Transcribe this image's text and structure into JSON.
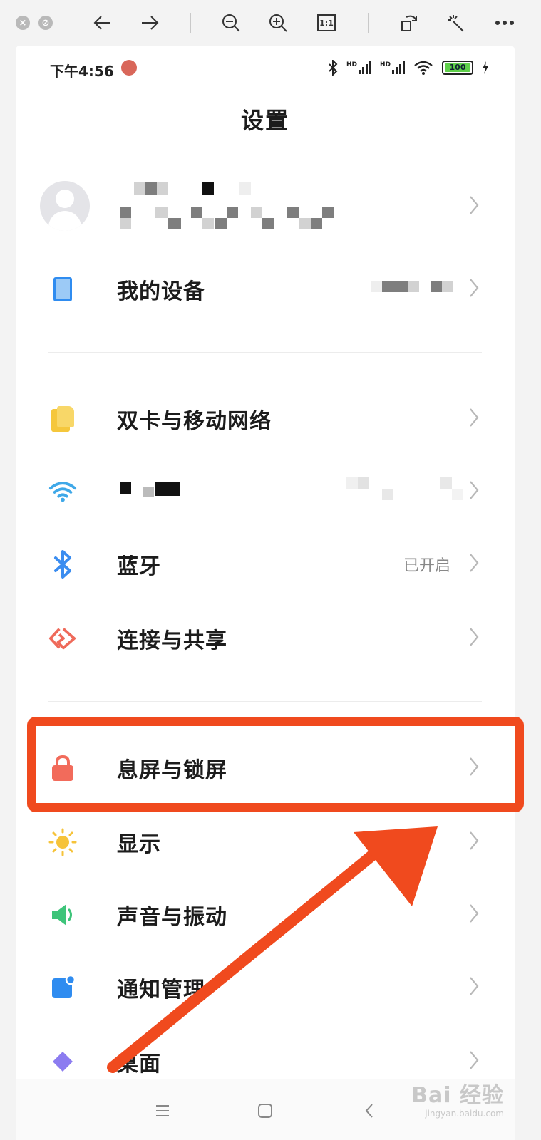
{
  "colors": {
    "accent_annotation": "#f04a1e",
    "device_icon": "#7db7f0",
    "sim_icon": "#f5c73c",
    "wifi_icon": "#3fa8e8",
    "bluetooth_icon": "#3b8df0",
    "share_icon": "#ef6a5a",
    "lock_icon": "#f26b5b",
    "display_icon": "#f6c33a",
    "sound_icon": "#3ec47a",
    "notify_icon": "#2f8cf0"
  },
  "viewer_toolbar": {
    "icons": [
      "close-icon",
      "minimize-icon",
      "back-arrow-icon",
      "forward-arrow-icon",
      "zoom-out-icon",
      "zoom-in-icon",
      "actual-size-icon",
      "rotate-icon",
      "magic-wand-icon",
      "more-icon"
    ],
    "actual_size_label": "1:1"
  },
  "status_bar": {
    "time": "下午4:56",
    "signal_1": "HD",
    "signal_2": "HD",
    "battery": "100"
  },
  "page": {
    "title": "设置"
  },
  "settings": {
    "my_device": {
      "label": "我的设备"
    },
    "sim": {
      "label": "双卡与移动网络"
    },
    "bluetooth": {
      "label": "蓝牙",
      "value": "已开启"
    },
    "connection": {
      "label": "连接与共享"
    },
    "lockscreen": {
      "label": "息屏与锁屏"
    },
    "display": {
      "label": "显示"
    },
    "sound": {
      "label": "声音与振动"
    },
    "notifications": {
      "label": "通知管理"
    },
    "partial_next": {
      "label": "桌面"
    }
  },
  "watermark": {
    "main": "Bai 经验",
    "sub": "jingyan.baidu.com"
  }
}
